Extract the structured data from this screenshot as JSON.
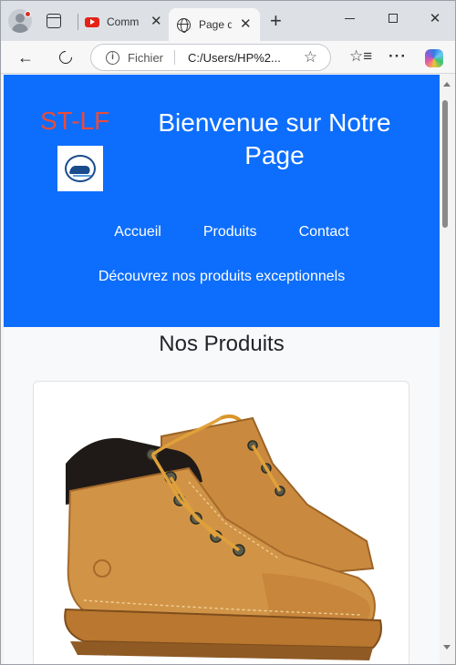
{
  "browser": {
    "tabs": [
      {
        "title": "Comm",
        "icon": "youtube-icon",
        "active": false
      },
      {
        "title": "Page d",
        "icon": "globe-icon",
        "active": true
      }
    ],
    "address": {
      "scheme_label": "Fichier",
      "url": "C:/Users/HP%2..."
    }
  },
  "page": {
    "brand": "ST-LF",
    "title": "Bienvenue sur Notre Page",
    "nav": [
      "Accueil",
      "Produits",
      "Contact"
    ],
    "tagline": "Découvrez nos produits exceptionnels",
    "section_title": "Nos Produits",
    "colors": {
      "hero": "#0d6efd",
      "brand": "#e74c3c"
    }
  }
}
